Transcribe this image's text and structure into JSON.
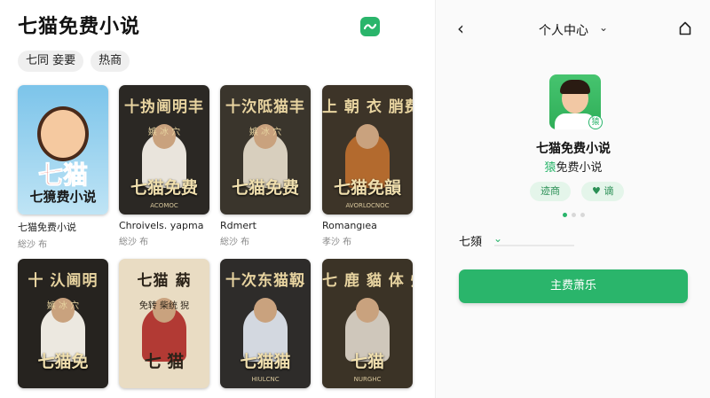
{
  "left": {
    "title": "七猫免费小说",
    "chips": [
      "七同  妾要",
      "热商"
    ],
    "books": [
      {
        "kind": "cartoon",
        "cover_top": "",
        "cover_mid": "",
        "cover_big": "七猫",
        "cover_sub": "七獍费小说",
        "title": "七猫免费小说",
        "sub": "総沙 布",
        "bg": "#7cc4ea",
        "figure": "#f5c9a0"
      },
      {
        "kind": "poster",
        "cover_top": "十㧑阃明丰",
        "cover_mid": "嫉 冰 穴",
        "cover_big": "七猫免费",
        "cover_sub": "ACOMOC",
        "title": "Chroivels. yapma",
        "sub": "総沙 布",
        "bg": "#2b2824",
        "figure": "#e9e4dc"
      },
      {
        "kind": "poster",
        "cover_top": "十㳄阺猫丰",
        "cover_mid": "嫉 冰 穴",
        "cover_big": "七猫免费",
        "cover_sub": "",
        "title": "Rdmert",
        "sub": "総沙 布",
        "bg": "#3a352c",
        "figure": "#d8cfbe"
      },
      {
        "kind": "poster",
        "cover_top": "上 朝 衣 䏴费",
        "cover_mid": "",
        "cover_big": "七猫免韻",
        "cover_sub": "AVORLOCNOC",
        "title": "Romangıea",
        "sub": "孝沙 布",
        "bg": "#3d3428",
        "figure": "#b36a2e"
      },
      {
        "kind": "poster",
        "cover_top": "十 汄阃明",
        "cover_mid": "嫉 冰 穴",
        "cover_big": "七猫免",
        "cover_sub": "",
        "title": "",
        "sub": "",
        "bg": "#26231f",
        "figure": "#ece8e0"
      },
      {
        "kind": "poster",
        "cover_top": "七猫 蒳",
        "cover_mid": "免转 柴统 猊",
        "cover_big": "七 猫",
        "cover_sub": "",
        "title": "",
        "sub": "",
        "bg": "#e9dcc3",
        "figure": "#b23a34"
      },
      {
        "kind": "poster",
        "cover_top": "十次东猫靱",
        "cover_mid": "",
        "cover_big": "七猫猫",
        "cover_sub": "HIULCNC",
        "title": "",
        "sub": "",
        "bg": "#2e2c2a",
        "figure": "#d3d8e0"
      },
      {
        "kind": "poster",
        "cover_top": "七 鹿 貓 体 帰",
        "cover_mid": "",
        "cover_big": "七猫",
        "cover_sub": "NURGHC",
        "title": "",
        "sub": "",
        "bg": "#3b3326",
        "figure": "#cfc7bb"
      }
    ]
  },
  "right": {
    "nav_title": "个人中心",
    "profile_name": "七猫免费小说",
    "profile_sub_accent": "猿",
    "profile_sub_rest": "免费小说",
    "badge": "猿",
    "pills": [
      "迹商",
      "♥ 谪"
    ],
    "section_label": "七頦",
    "main_button": "主费萧乐"
  },
  "colors": {
    "accent": "#2ab56b"
  }
}
